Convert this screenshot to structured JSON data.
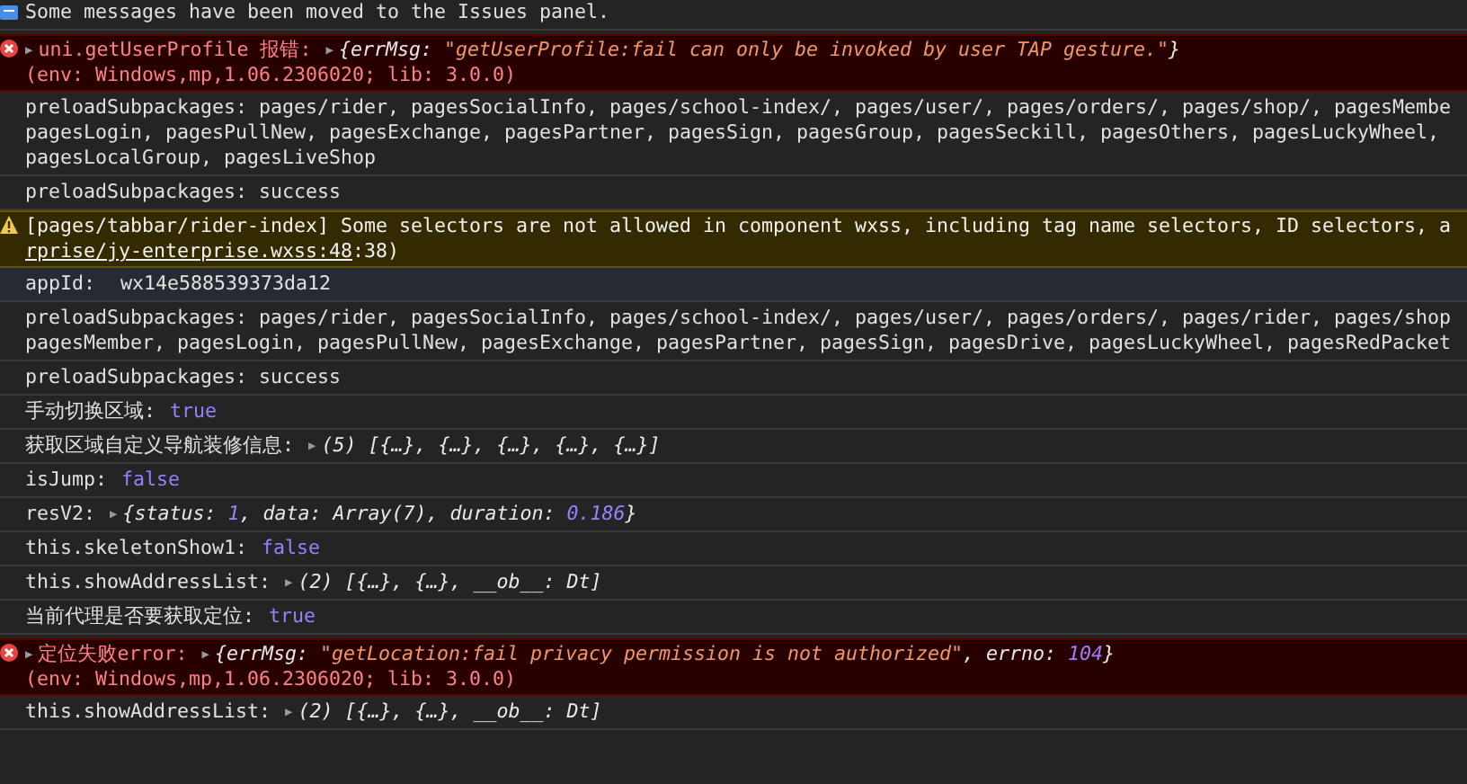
{
  "console": {
    "messages": [
      {
        "kind": "info",
        "highlighted": false,
        "lines": [
          [
            {
              "kind": "plain",
              "text": "Some messages have been moved to the Issues panel."
            }
          ]
        ]
      },
      {
        "kind": "error",
        "highlighted": false,
        "lines": [
          [
            {
              "kind": "caret",
              "text": "▶"
            },
            {
              "kind": "label",
              "text": "uni.getUserProfile 报错:"
            },
            {
              "kind": "caret",
              "text": "▶"
            },
            {
              "kind": "obj",
              "text": "{errMsg: "
            },
            {
              "kind": "string",
              "text": "\"getUserProfile:fail can only be invoked by user TAP gesture.\""
            },
            {
              "kind": "obj",
              "text": "}"
            }
          ],
          [
            {
              "kind": "label",
              "text": "(env: Windows,mp,1.06.2306020; lib: 3.0.0)"
            }
          ]
        ]
      },
      {
        "kind": "log",
        "highlighted": false,
        "lines": [
          [
            {
              "kind": "plain",
              "text": "preloadSubpackages: pages/rider, pagesSocialInfo, pages/school-index/, pages/user/, pages/orders/, pages/shop/, pagesMembe"
            }
          ],
          [
            {
              "kind": "plain",
              "text": "pagesLogin, pagesPullNew, pagesExchange, pagesPartner, pagesSign, pagesGroup, pagesSeckill, pagesOthers, pagesLuckyWheel,"
            }
          ],
          [
            {
              "kind": "plain",
              "text": "pagesLocalGroup, pagesLiveShop"
            }
          ]
        ]
      },
      {
        "kind": "log",
        "highlighted": false,
        "lines": [
          [
            {
              "kind": "plain",
              "text": "preloadSubpackages: success"
            }
          ]
        ]
      },
      {
        "kind": "warning",
        "highlighted": false,
        "lines": [
          [
            {
              "kind": "plain",
              "text": "[pages/tabbar/rider-index] Some selectors are not allowed in component wxss, including tag name selectors, ID selectors, a"
            }
          ],
          [
            {
              "kind": "link",
              "text": "rprise/jy-enterprise.wxss:48"
            },
            {
              "kind": "plain",
              "text": ":38)"
            }
          ]
        ]
      },
      {
        "kind": "log",
        "highlighted": true,
        "lines": [
          [
            {
              "kind": "plain",
              "text": "appId:"
            },
            {
              "kind": "plain",
              "text": "wx14e588539373da12"
            }
          ]
        ]
      },
      {
        "kind": "log",
        "highlighted": false,
        "lines": [
          [
            {
              "kind": "plain",
              "text": "preloadSubpackages: pages/rider, pagesSocialInfo, pages/school-index/, pages/user/, pages/orders/, pages/rider, pages/shop"
            }
          ],
          [
            {
              "kind": "plain",
              "text": "pagesMember, pagesLogin, pagesPullNew, pagesExchange, pagesPartner, pagesSign, pagesDrive, pagesLuckyWheel, pagesRedPacket"
            }
          ]
        ]
      },
      {
        "kind": "log",
        "highlighted": false,
        "lines": [
          [
            {
              "kind": "plain",
              "text": "preloadSubpackages: success"
            }
          ]
        ]
      },
      {
        "kind": "log",
        "highlighted": false,
        "lines": [
          [
            {
              "kind": "plain",
              "text": "手动切换区域:"
            },
            {
              "kind": "bool",
              "text": "true"
            }
          ]
        ]
      },
      {
        "kind": "log",
        "highlighted": false,
        "lines": [
          [
            {
              "kind": "plain",
              "text": "获取区域自定义导航装修信息:"
            },
            {
              "kind": "caret",
              "text": "▶"
            },
            {
              "kind": "obj",
              "text": "(5) [{…}, {…}, {…}, {…}, {…}]"
            }
          ]
        ]
      },
      {
        "kind": "log",
        "highlighted": false,
        "lines": [
          [
            {
              "kind": "plain",
              "text": "isJump:"
            },
            {
              "kind": "bool",
              "text": "false"
            }
          ]
        ]
      },
      {
        "kind": "log",
        "highlighted": false,
        "lines": [
          [
            {
              "kind": "plain",
              "text": "resV2:"
            },
            {
              "kind": "caret",
              "text": "▶"
            },
            {
              "kind": "obj",
              "text": "{status: "
            },
            {
              "kind": "number",
              "text": "1"
            },
            {
              "kind": "obj",
              "text": ", data: Array(7), duration: "
            },
            {
              "kind": "number",
              "text": "0.186"
            },
            {
              "kind": "obj",
              "text": "}"
            }
          ]
        ]
      },
      {
        "kind": "log",
        "highlighted": false,
        "lines": [
          [
            {
              "kind": "plain",
              "text": "this.skeletonShow1:"
            },
            {
              "kind": "bool",
              "text": "false"
            }
          ]
        ]
      },
      {
        "kind": "log",
        "highlighted": false,
        "lines": [
          [
            {
              "kind": "plain",
              "text": "this.showAddressList:"
            },
            {
              "kind": "caret",
              "text": "▶"
            },
            {
              "kind": "obj",
              "text": "(2) [{…}, {…}, __ob__: Dt]"
            }
          ]
        ]
      },
      {
        "kind": "log",
        "highlighted": false,
        "lines": [
          [
            {
              "kind": "plain",
              "text": "当前代理是否要获取定位:"
            },
            {
              "kind": "bool",
              "text": "true"
            }
          ]
        ]
      },
      {
        "kind": "error",
        "highlighted": false,
        "lines": [
          [
            {
              "kind": "caret",
              "text": "▶"
            },
            {
              "kind": "label",
              "text": "定位失败error:"
            },
            {
              "kind": "caret",
              "text": "▶"
            },
            {
              "kind": "obj",
              "text": "{errMsg: "
            },
            {
              "kind": "string",
              "text": "\"getLocation:fail privacy permission is not authorized\""
            },
            {
              "kind": "obj",
              "text": ", errno: "
            },
            {
              "kind": "number",
              "text": "104"
            },
            {
              "kind": "obj",
              "text": "}"
            }
          ],
          [
            {
              "kind": "label",
              "text": "(env: Windows,mp,1.06.2306020; lib: 3.0.0)"
            }
          ]
        ]
      },
      {
        "kind": "log",
        "highlighted": false,
        "lines": [
          [
            {
              "kind": "plain",
              "text": "this.showAddressList:"
            },
            {
              "kind": "caret",
              "text": "▶"
            },
            {
              "kind": "obj",
              "text": "(2) [{…}, {…}, __ob__: Dt]"
            }
          ]
        ]
      }
    ]
  }
}
